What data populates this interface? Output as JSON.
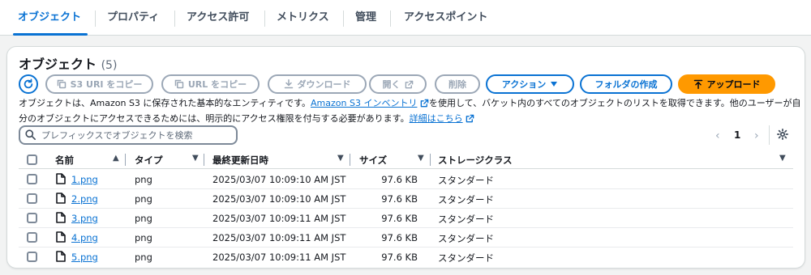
{
  "tabs": [
    {
      "label": "オブジェクト"
    },
    {
      "label": "プロパティ"
    },
    {
      "label": "アクセス許可"
    },
    {
      "label": "メトリクス"
    },
    {
      "label": "管理"
    },
    {
      "label": "アクセスポイント"
    }
  ],
  "panel": {
    "title": "オブジェクト",
    "count": "(5)"
  },
  "toolbar": {
    "s3_uri_copy": "S3 URI をコピー",
    "url_copy": "URL をコピー",
    "download": "ダウンロード",
    "open": "開く",
    "delete": "削除",
    "actions": "アクション",
    "create_folder": "フォルダの作成",
    "upload": "アップロード"
  },
  "description": {
    "part1": "オブジェクトは、Amazon S3 に保存された基本的なエンティティです。",
    "inventory_link": "Amazon S3 インベントリ",
    "part2": "を使用して、バケット内のすべてのオブジェクトのリストを取得できます。他のユーザーが自分のオブジェクトにアクセスできるためには、明示的にアクセス権限を付与する必要があります。",
    "details_link": "詳細はこちら"
  },
  "search": {
    "placeholder": "プレフィックスでオブジェクトを検索"
  },
  "pagination": {
    "current_page": "1"
  },
  "table": {
    "columns": [
      "名前",
      "タイプ",
      "最終更新日時",
      "サイズ",
      "ストレージクラス"
    ],
    "rows": [
      {
        "name": "1.png",
        "type": "png",
        "modified": "2025/03/07 10:09:10 AM JST",
        "size": "97.6 KB",
        "storage": "スタンダード"
      },
      {
        "name": "2.png",
        "type": "png",
        "modified": "2025/03/07 10:09:10 AM JST",
        "size": "97.6 KB",
        "storage": "スタンダード"
      },
      {
        "name": "3.png",
        "type": "png",
        "modified": "2025/03/07 10:09:11 AM JST",
        "size": "97.6 KB",
        "storage": "スタンダード"
      },
      {
        "name": "4.png",
        "type": "png",
        "modified": "2025/03/07 10:09:11 AM JST",
        "size": "97.6 KB",
        "storage": "スタンダード"
      },
      {
        "name": "5.png",
        "type": "png",
        "modified": "2025/03/07 10:09:11 AM JST",
        "size": "97.6 KB",
        "storage": "スタンダード"
      }
    ]
  },
  "colors": {
    "accent": "#0972d3",
    "upload": "#ff9900",
    "disabled": "#9ba7b6"
  }
}
